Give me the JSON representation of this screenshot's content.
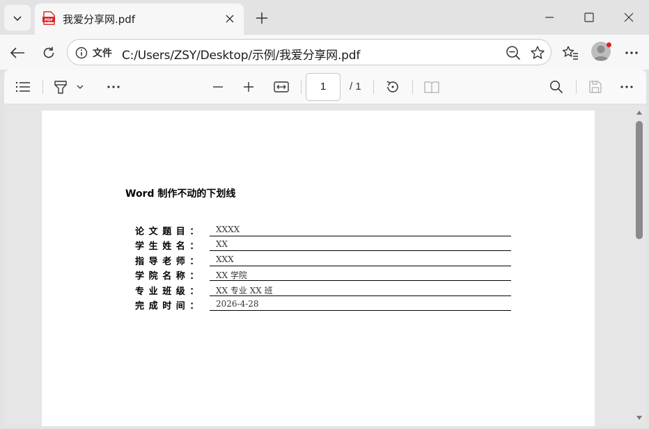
{
  "tab": {
    "title": "我爱分享网.pdf",
    "favicon_text": "PDF"
  },
  "address": {
    "label": "文件",
    "url": "C:/Users/ZSY/Desktop/示例/我爱分享网.pdf"
  },
  "pdf_toolbar": {
    "current_page": "1",
    "total_pages": "/ 1"
  },
  "document": {
    "title": "Word 制作不动的下划线",
    "fields": [
      {
        "label": "论文题目：",
        "value": "XXXX"
      },
      {
        "label": "学生姓名：",
        "value": "XX"
      },
      {
        "label": "指导老师：",
        "value": "XXX"
      },
      {
        "label": "学院名称：",
        "value": "XX 学院"
      },
      {
        "label": "专业班级：",
        "value": "XX 专业 XX 班"
      },
      {
        "label": "完成时间：",
        "value": "2026-4-28"
      }
    ]
  },
  "colors": {
    "pdf_icon_red": "#d8232a",
    "profile_badge": "#d8232a"
  }
}
